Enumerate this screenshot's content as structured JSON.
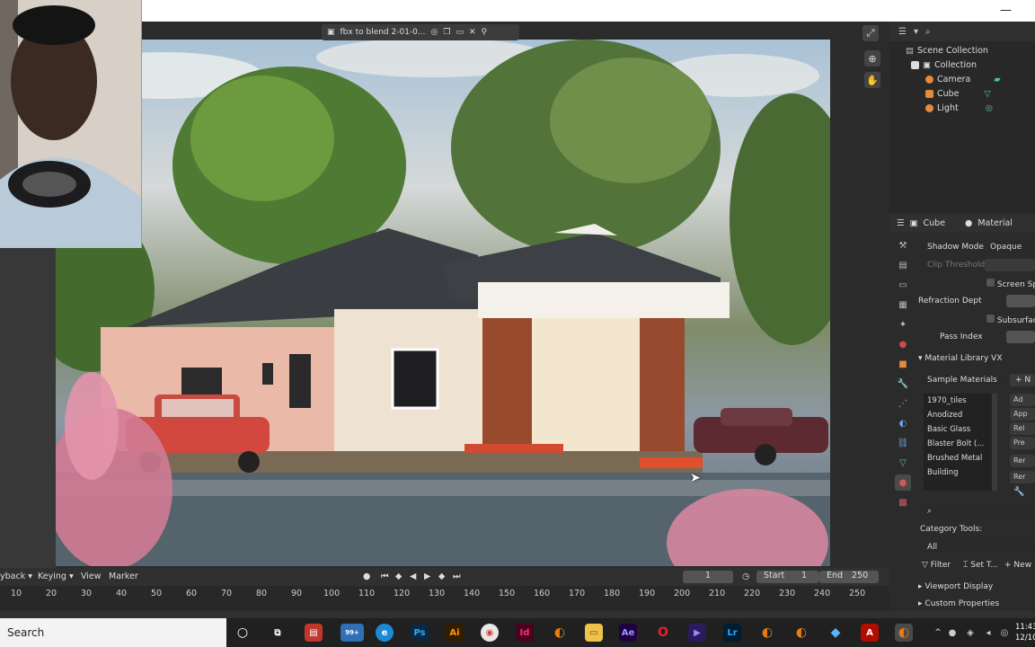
{
  "viewport": {
    "file_label": "fbx to blend 2-01-0..."
  },
  "outliner": {
    "root": "Scene Collection",
    "items": [
      {
        "name": "Collection",
        "icon": "collection-icon"
      },
      {
        "name": "Camera",
        "icon": "camera-icon"
      },
      {
        "name": "Cube",
        "icon": "cube-icon"
      },
      {
        "name": "Light",
        "icon": "light-icon"
      }
    ]
  },
  "properties": {
    "object": "Cube",
    "tab": "Material",
    "shadow_mode_label": "Shadow Mode",
    "shadow_mode_value": "Opaque",
    "clip_threshold_label": "Clip Threshold",
    "screen_space_label": "Screen Spa",
    "refraction_depth_label": "Refraction Dept",
    "subsurface_label": "Subsurface",
    "pass_index_label": "Pass Index",
    "material_library": "Material Library VX",
    "library_select": "Sample Materials",
    "materials": [
      "1970_tiles",
      "Anodized",
      "Basic Glass",
      "Blaster Bolt (...",
      "Brushed Metal",
      "Building"
    ],
    "side_buttons": [
      "Ad",
      "App",
      "Rel",
      "Pre",
      "Rer",
      "Rer"
    ],
    "category_tools": "Category Tools:",
    "category_all": "All",
    "filter": "Filter",
    "set": "Set T...",
    "new": "New",
    "viewport_display": "Viewport Display",
    "custom_properties": "Custom Properties"
  },
  "timeline": {
    "playback": "yback",
    "keying": "Keying",
    "view": "View",
    "marker": "Marker",
    "current_frame": "1",
    "start_label": "Start",
    "start_value": "1",
    "end_label": "End",
    "end_value": "250",
    "ticks": [
      "10",
      "20",
      "30",
      "40",
      "50",
      "60",
      "70",
      "80",
      "90",
      "100",
      "110",
      "120",
      "130",
      "140",
      "150",
      "160",
      "170",
      "180",
      "190",
      "200",
      "210",
      "220",
      "230",
      "240",
      "250"
    ]
  },
  "taskbar": {
    "search": "Search",
    "badge": "99+",
    "time": "11:43",
    "date": "12/10"
  }
}
